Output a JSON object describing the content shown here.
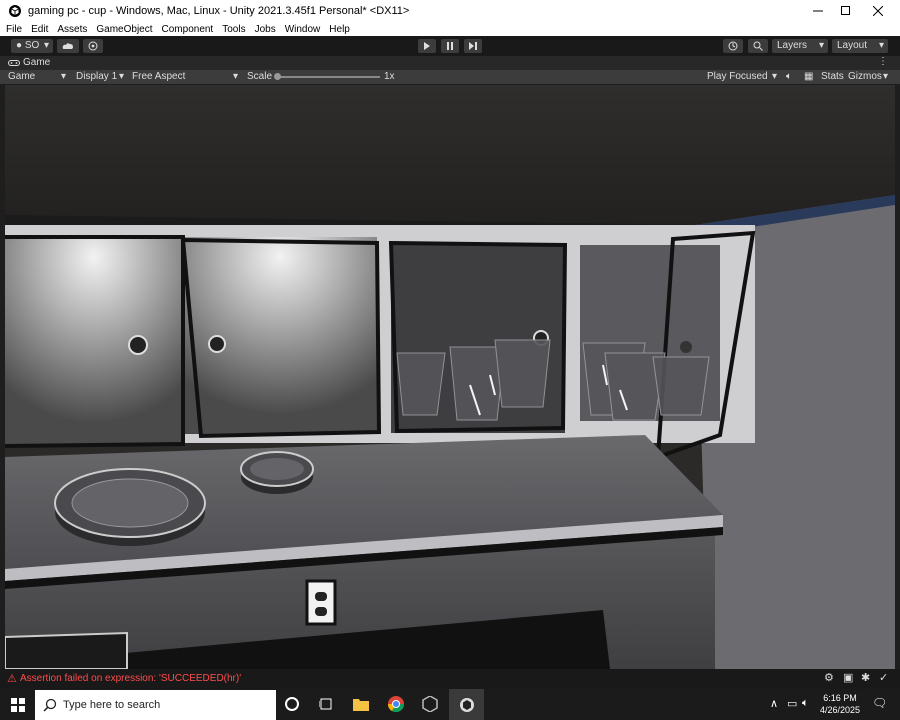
{
  "window": {
    "title": "gaming pc - cup - Windows, Mac, Linux - Unity 2021.3.45f1 Personal* <DX11>"
  },
  "menu": [
    "File",
    "Edit",
    "Assets",
    "GameObject",
    "Component",
    "Tools",
    "Jobs",
    "Window",
    "Help"
  ],
  "toolbar": {
    "account_label": "SO",
    "layers_label": "Layers",
    "layout_label": "Layout"
  },
  "game_view": {
    "tab_label": "Game",
    "mode_label": "Game",
    "display_label": "Display 1",
    "aspect_label": "Free Aspect",
    "scale_label": "Scale",
    "scale_value": "1x",
    "play_focused_label": "Play Focused",
    "stats_label": "Stats",
    "gizmos_label": "Gizmos"
  },
  "console": {
    "message": "Assertion failed on expression: 'SUCCEEDED(hr)'"
  },
  "taskbar": {
    "search_placeholder": "Type here to search",
    "time": "6:16 PM",
    "date": "4/26/2025"
  },
  "colors": {
    "editor_bg": "#191919",
    "toolbar_button": "#3c3c3c",
    "error_text": "#ff4c4c"
  }
}
